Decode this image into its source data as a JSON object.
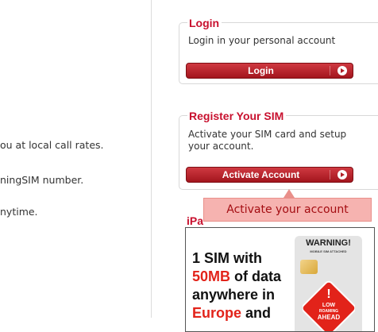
{
  "left_column": {
    "lines": [
      "ou at local call rates.",
      "ningSIM number.",
      "nytime."
    ]
  },
  "login_box": {
    "title": "Login",
    "description": "Login in your personal account",
    "button_label": "Login"
  },
  "register_box": {
    "title": "Register Your SIM",
    "description": "Activate your SIM card and setup your account.",
    "button_label": "Activate Account"
  },
  "tooltip": {
    "text": "Activate your account"
  },
  "ad_box": {
    "title_fragment": "iPa",
    "lines": [
      "1 SIM with",
      "50MB",
      " of data",
      "anywhere in",
      "Europe",
      " and"
    ],
    "warning_title": "WARNING!",
    "warning_subtitle": "MOBILE SIM ATTACHED",
    "sign_text": [
      "LOW",
      "ROAMING",
      "AHEAD"
    ]
  },
  "colors": {
    "accent_red": "#c8102e",
    "button_red": "#b11e26",
    "tooltip_bg": "#f6b3b0"
  }
}
